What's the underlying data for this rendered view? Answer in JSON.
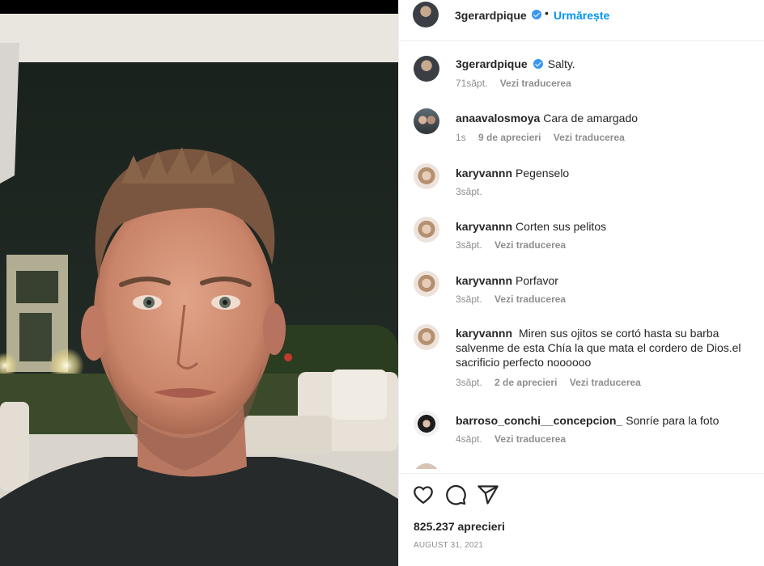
{
  "post": {
    "username": "3gerardpique",
    "follow_label": "Urmărește",
    "separator": "•",
    "caption": "Salty.",
    "caption_time": "71săpt.",
    "caption_translate": "Vezi traducerea",
    "likes": "825.237 aprecieri",
    "date": "AUGUST 31, 2021"
  },
  "comments": [
    {
      "username": "anaavalosmoya",
      "text": "Cara de amargado",
      "time": "1s",
      "likes": "9 de aprecieri",
      "translate": "Vezi traducerea"
    },
    {
      "username": "karyvannn",
      "text": "Pegenselo",
      "time": "3săpt."
    },
    {
      "username": "karyvannn",
      "text": "Corten sus pelitos",
      "time": "3săpt.",
      "translate": "Vezi traducerea"
    },
    {
      "username": "karyvannn",
      "text": "Porfavor",
      "time": "3săpt.",
      "translate": "Vezi traducerea"
    },
    {
      "username": "karyvannn",
      "text": "Miren sus ojitos se cortó hasta su barba salvenme de esta Chía la que mata el cordero de Dios.el sacrificio perfecto noooooo",
      "time": "3săpt.",
      "likes": "2 de aprecieri",
      "translate": "Vezi traducerea"
    },
    {
      "username": "barroso_conchi__concepcion_",
      "text": "Sonríe para la foto",
      "time": "4săpt.",
      "translate": "Vezi traducerea"
    }
  ],
  "icons": [
    "heart-icon",
    "comment-icon",
    "share-icon",
    "verified-badge-icon"
  ],
  "colors": {
    "accent": "#0095f6",
    "verified": "#3897f0",
    "muted": "#8e8e8e"
  }
}
